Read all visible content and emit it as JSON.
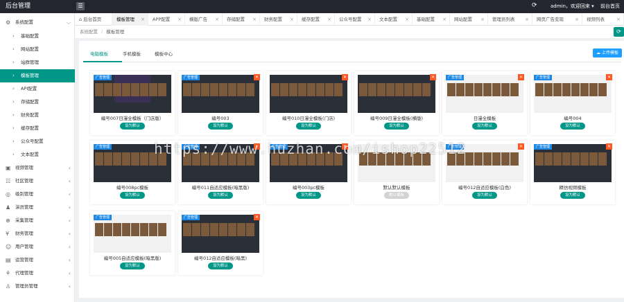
{
  "topbar": {
    "brand": "后台管理",
    "menu_icon": "☰",
    "refresh_icon": "⟳",
    "user_text": "admin，欢迎回来 ▾",
    "home_text": "前台首页"
  },
  "sidebar": {
    "items": [
      {
        "label": "系统配置",
        "icon": "⚙",
        "arrow": "⌵"
      },
      {
        "label": "基础配置",
        "icon": "›",
        "sub": true
      },
      {
        "label": "网站配置",
        "icon": "›",
        "sub": true
      },
      {
        "label": "站群管理",
        "icon": "›",
        "sub": true
      },
      {
        "label": "模板管理",
        "icon": "›",
        "sub": true,
        "active": true
      },
      {
        "label": "API配置",
        "icon": "›",
        "sub": true
      },
      {
        "label": "存储配置",
        "icon": "›",
        "sub": true
      },
      {
        "label": "财务配置",
        "icon": "›",
        "sub": true
      },
      {
        "label": "缓存配置",
        "icon": "›",
        "sub": true
      },
      {
        "label": "公众号配置",
        "icon": "›",
        "sub": true
      },
      {
        "label": "文本配置",
        "icon": "›",
        "sub": true
      },
      {
        "label": "视频管理",
        "icon": "▣",
        "arrow": "‹"
      },
      {
        "label": "社区管理",
        "icon": "☷",
        "arrow": "‹"
      },
      {
        "label": "级别管理",
        "icon": "◎",
        "arrow": "‹"
      },
      {
        "label": "演员管理",
        "icon": "♟",
        "arrow": "‹"
      },
      {
        "label": "采集管理",
        "icon": "⊕",
        "arrow": "‹"
      },
      {
        "label": "财务管理",
        "icon": "¥",
        "arrow": "‹"
      },
      {
        "label": "用户管理",
        "icon": "☺",
        "arrow": "‹"
      },
      {
        "label": "运营管理",
        "icon": "▤",
        "arrow": "‹"
      },
      {
        "label": "代理管理",
        "icon": "⚘",
        "arrow": "‹"
      },
      {
        "label": "管理员管理",
        "icon": "♙",
        "arrow": "‹"
      }
    ]
  },
  "tabs": [
    {
      "label": "后台首页"
    },
    {
      "label": "模板管理",
      "active": true
    },
    {
      "label": "APP配置"
    },
    {
      "label": "横版广告"
    },
    {
      "label": "存储配置"
    },
    {
      "label": "财务配置"
    },
    {
      "label": "缓存配置"
    },
    {
      "label": "公众号配置"
    },
    {
      "label": "文本配置"
    },
    {
      "label": "基础配置"
    },
    {
      "label": "网站配置"
    },
    {
      "label": "管理员列表"
    },
    {
      "label": "网页广告变现"
    },
    {
      "label": "视频列表"
    }
  ],
  "breadcrumb": {
    "home": "系统配置",
    "sep": "/",
    "current": "模板管理"
  },
  "subtabs": [
    "电脑模板",
    "手机模板",
    "模板中心"
  ],
  "upload_label": "上传模板",
  "cards": [
    {
      "name": "编号007日漫全模板（门店版）",
      "button": "设为默认",
      "badge": "广告管理",
      "theme": "dark"
    },
    {
      "name": "编号003",
      "button": "设为默认",
      "badge": "广告管理",
      "theme": "dark"
    },
    {
      "name": "编号010日漫全模板(门店)",
      "button": "设为默认",
      "badge": "",
      "theme": "dark"
    },
    {
      "name": "编号009日漫全模板(横版)",
      "button": "设为默认",
      "badge": "",
      "theme": "dark"
    },
    {
      "name": "日漫全模板",
      "button": "设为默认",
      "badge": "广告管理",
      "theme": "light"
    },
    {
      "name": "编号004",
      "button": "设为默认",
      "badge": "广告管理",
      "theme": "light"
    },
    {
      "name": "编号008pc模板",
      "button": "设为默认",
      "badge": "广告管理",
      "theme": "dark"
    },
    {
      "name": "编号011自适应模板(暗黑版)",
      "button": "设为默认",
      "badge": "广告管理",
      "theme": "dark"
    },
    {
      "name": "编号003pc模板",
      "button": "设为默认",
      "badge": "广告管理",
      "theme": "dark"
    },
    {
      "name": "默认默认模板",
      "button": "默认模板",
      "badge": "",
      "theme": "light",
      "disabled": true
    },
    {
      "name": "编号012自适应模板(白色)",
      "button": "设为默认",
      "badge": "广告管理",
      "theme": "light"
    },
    {
      "name": "精仿视频模板",
      "button": "设为默认",
      "badge": "广告管理",
      "theme": "dark"
    },
    {
      "name": "编号005自适应模板(暗黑版)",
      "button": "设为默认",
      "badge": "广告管理",
      "theme": "light"
    },
    {
      "name": "编号012自适应模板(暗黑)",
      "button": "设为默认",
      "badge": "广告管理",
      "theme": "dark"
    }
  ],
  "watermark": "https://www.huzhan.com/ishop22512",
  "colors": {
    "accent": "#009688",
    "topbar": "#23262e",
    "upload": "#1e9fff",
    "delete": "#ff5722"
  }
}
